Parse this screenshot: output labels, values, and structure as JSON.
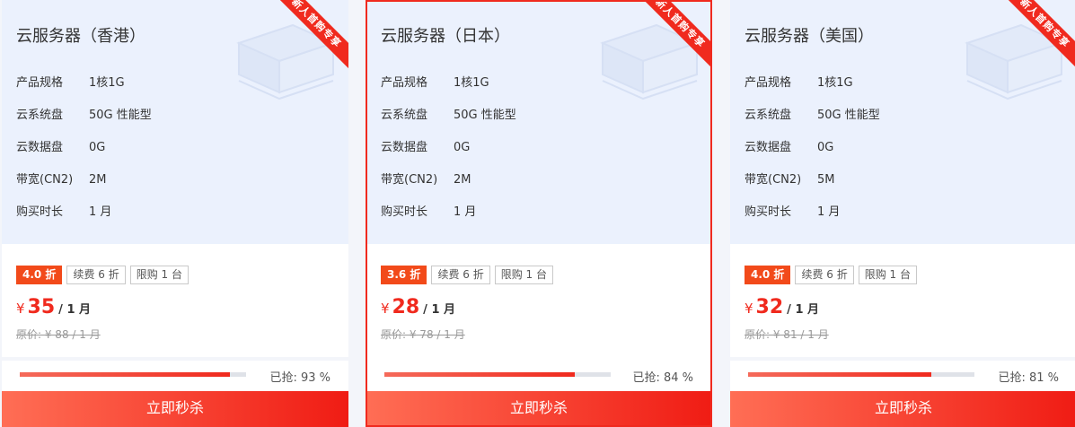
{
  "ribbon_text": "新人首购专享",
  "buy_label": "立即秒杀",
  "accent_color": "#f02a1e",
  "spec_labels": {
    "spec": "产品规格",
    "sys_disk": "云系统盘",
    "data_disk": "云数据盘",
    "bandwidth": "带宽(CN2)",
    "duration": "购买时长"
  },
  "cards": [
    {
      "title": "云服务器（香港）",
      "spec": "1核1G",
      "sys_disk": "50G 性能型",
      "data_disk": "0G",
      "bandwidth": "2M",
      "duration": "1 月",
      "discount": "4.0 折",
      "renew": "续费 6 折",
      "limit": "限购 1 台",
      "currency": "¥",
      "price": "35",
      "unit": "/ 1 月",
      "original": "原价: ¥ 88 / 1 月",
      "sold_pct": 93,
      "sold_text": "已抢:   93 %",
      "selected": false
    },
    {
      "title": "云服务器（日本）",
      "spec": "1核1G",
      "sys_disk": "50G 性能型",
      "data_disk": "0G",
      "bandwidth": "2M",
      "duration": "1 月",
      "discount": "3.6 折",
      "renew": "续费 6 折",
      "limit": "限购 1 台",
      "currency": "¥",
      "price": "28",
      "unit": "/ 1 月",
      "original": "原价: ¥ 78 / 1 月",
      "sold_pct": 84,
      "sold_text": "已抢:   84 %",
      "selected": true
    },
    {
      "title": "云服务器（美国）",
      "spec": "1核1G",
      "sys_disk": "50G 性能型",
      "data_disk": "0G",
      "bandwidth": "5M",
      "duration": "1 月",
      "discount": "4.0 折",
      "renew": "续费 6 折",
      "limit": "限购 1 台",
      "currency": "¥",
      "price": "32",
      "unit": "/ 1 月",
      "original": "原价: ¥ 81 / 1 月",
      "sold_pct": 81,
      "sold_text": "已抢:   81 %",
      "selected": false
    }
  ]
}
